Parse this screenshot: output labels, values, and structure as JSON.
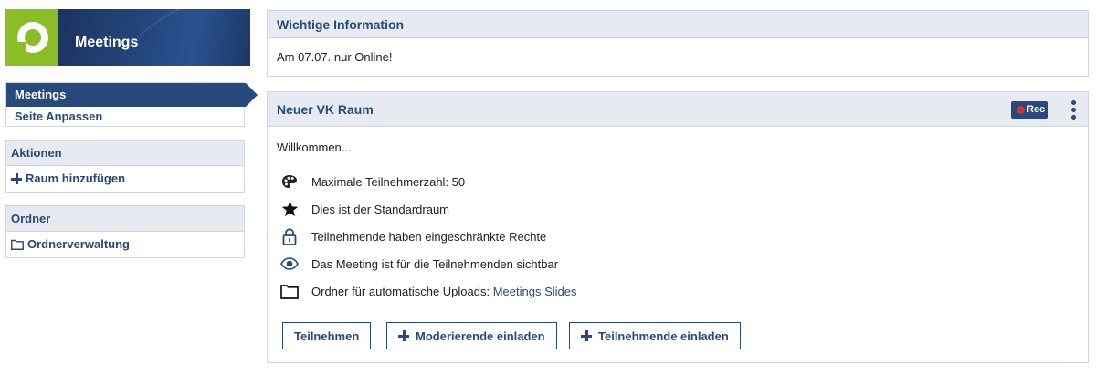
{
  "logo": {
    "title": "Meetings"
  },
  "nav": {
    "items": [
      {
        "label": "Meetings",
        "active": true
      },
      {
        "label": "Seite Anpassen",
        "active": false
      }
    ]
  },
  "actions": {
    "title": "Aktionen",
    "add_room": "Raum hinzufügen"
  },
  "folders": {
    "title": "Ordner",
    "manage": "Ordnerverwaltung"
  },
  "info": {
    "title": "Wichtige Information",
    "text": "Am 07.07. nur Online!"
  },
  "room": {
    "title": "Neuer VK Raum",
    "rec_label": "Rec",
    "welcome": "Willkommen...",
    "features": [
      {
        "icon": "palette-icon",
        "text": "Maximale Teilnehmerzahl: 50"
      },
      {
        "icon": "star-icon",
        "text": "Dies ist der Standardraum"
      },
      {
        "icon": "lock-icon",
        "text": "Teilnehmende haben eingeschränkte Rechte"
      },
      {
        "icon": "eye-icon",
        "text": "Das Meeting ist für die Teilnehmenden sichtbar"
      },
      {
        "icon": "folder-icon",
        "text": "Ordner für automatische Uploads: ",
        "link": "Meetings Slides"
      }
    ],
    "buttons": {
      "join": "Teilnehmen",
      "invite_moderators": "Moderierende einladen",
      "invite_participants": "Teilnehmende einladen"
    }
  },
  "colors": {
    "primary": "#28497c",
    "accent_green": "#8bbd24",
    "rec_red": "#d0362f",
    "panel_bg": "#e7ebf1",
    "border": "#d0d7e1"
  }
}
